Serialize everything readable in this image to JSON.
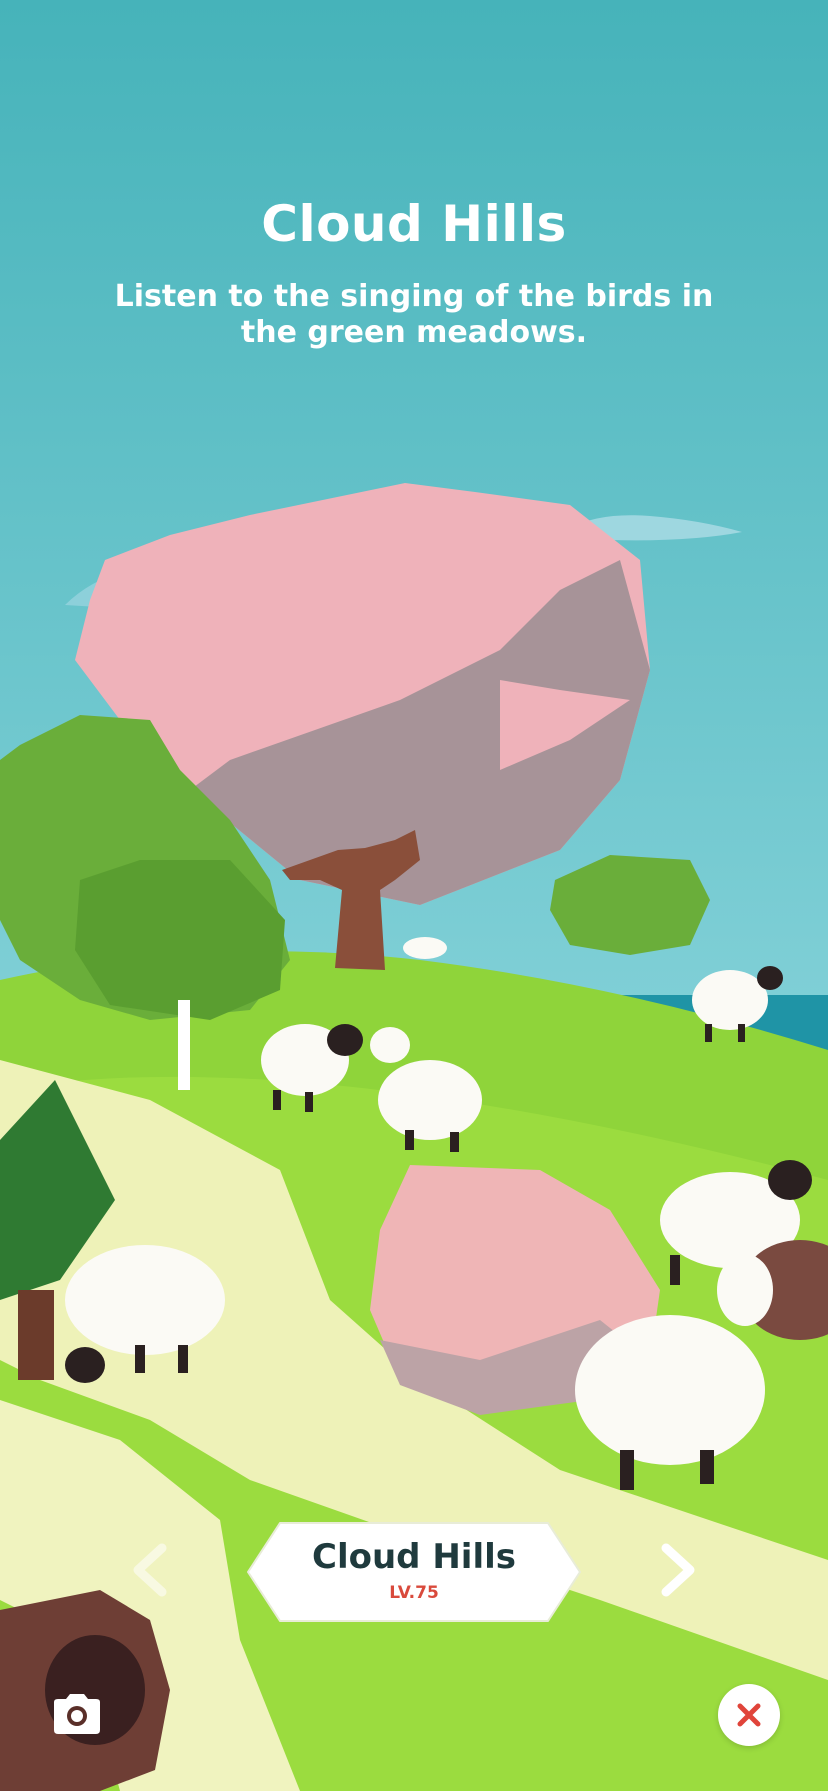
{
  "screen": {
    "title": "Cloud Hills",
    "subtitle": "Listen to the singing of the birds in the green meadows."
  },
  "level_selector": {
    "name": "Cloud Hills",
    "level": "LV.75"
  },
  "controls": {
    "prev_icon": "chevron-left-icon",
    "next_icon": "chevron-right-icon",
    "camera_icon": "camera-icon",
    "close_icon": "close-icon"
  },
  "colors": {
    "sky": "#4ab5bc",
    "grass": "#8fd43a",
    "blossom": "#efb2ba",
    "close_x": "#e0443a",
    "level_text": "#d94a3c"
  }
}
